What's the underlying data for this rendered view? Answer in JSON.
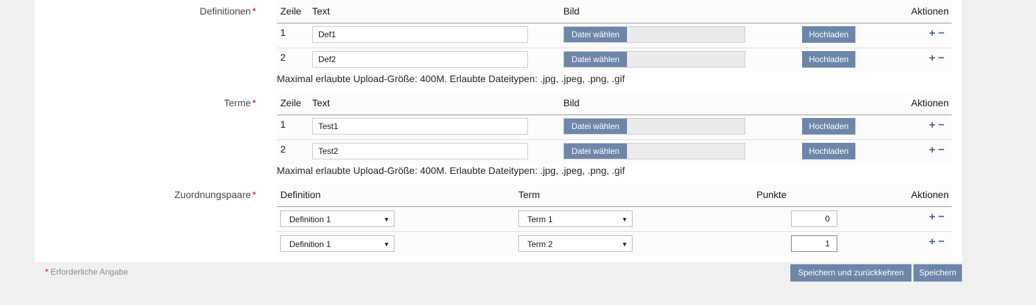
{
  "definitions": {
    "label": "Definitionen",
    "headers": {
      "row": "Zeile",
      "text": "Text",
      "image": "Bild",
      "actions": "Aktionen"
    },
    "rows": [
      {
        "num": "1",
        "text": "Def1",
        "file_btn": "Datei wählen",
        "upload_btn": "Hochladen"
      },
      {
        "num": "2",
        "text": "Def2",
        "file_btn": "Datei wählen",
        "upload_btn": "Hochladen"
      }
    ],
    "note": "Maximal erlaubte Upload-Größe: 400M. Erlaubte Dateitypen: .jpg, .jpeg, .png, .gif"
  },
  "terms": {
    "label": "Terme",
    "headers": {
      "row": "Zeile",
      "text": "Text",
      "image": "Bild",
      "actions": "Aktionen"
    },
    "rows": [
      {
        "num": "1",
        "text": "Test1",
        "file_btn": "Datei wählen",
        "upload_btn": "Hochladen"
      },
      {
        "num": "2",
        "text": "Test2",
        "file_btn": "Datei wählen",
        "upload_btn": "Hochladen"
      }
    ],
    "note": "Maximal erlaubte Upload-Größe: 400M. Erlaubte Dateitypen: .jpg, .jpeg, .png, .gif"
  },
  "pairs": {
    "label": "Zuordnungspaare",
    "headers": {
      "definition": "Definition",
      "term": "Term",
      "points": "Punkte",
      "actions": "Aktionen"
    },
    "rows": [
      {
        "definition": "Definition 1",
        "term": "Term 1",
        "points": "0"
      },
      {
        "definition": "Definition 1",
        "term": "Term 2",
        "points": "1"
      }
    ]
  },
  "icons": {
    "plus": "+",
    "minus": "−",
    "caret": "▼",
    "required": "*"
  },
  "footer": {
    "required_note": "Erforderliche Angabe",
    "save_return": "Speichern und zurückkehren",
    "save": "Speichern"
  },
  "colors": {
    "accent": "#6d86aa",
    "required": "#dd0000",
    "action_icon": "#4c6586"
  }
}
